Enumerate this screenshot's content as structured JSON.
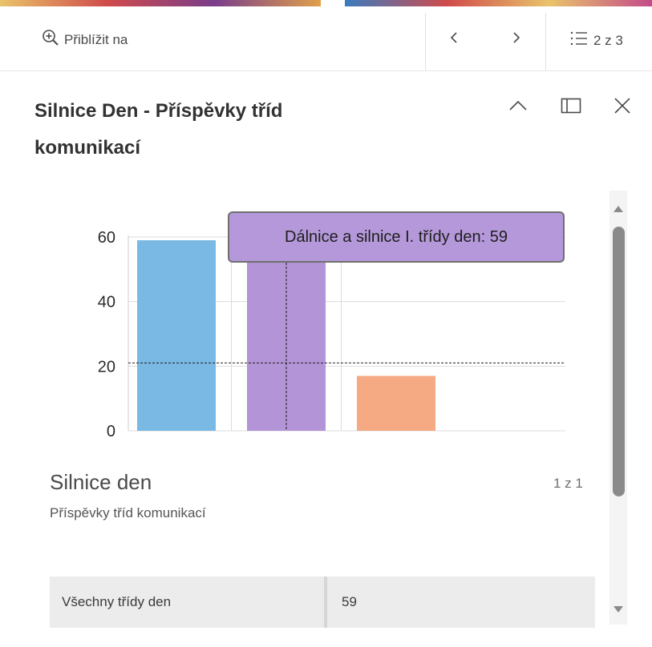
{
  "toolbar": {
    "zoom_label": "Přiblížit na",
    "zoom_icon": "zoom-in-icon",
    "prev_icon": "chevron-left-icon",
    "next_icon": "chevron-right-icon",
    "list_icon": "list-icon",
    "counter_text": "2 z 3"
  },
  "popup": {
    "title_line1": "Silnice Den - Příspěvky tříd",
    "title_line2": "komunikací",
    "collapse_icon": "chevron-up-icon",
    "dock_icon": "dock-icon",
    "close_icon": "close-icon"
  },
  "chart_data": {
    "type": "bar",
    "categories": [
      "",
      "",
      ""
    ],
    "values": [
      59,
      59,
      17
    ],
    "colors": [
      "#7ab9e3",
      "#b394d6",
      "#f6aa83"
    ],
    "ylim": [
      0,
      60
    ],
    "yticks": [
      0,
      20,
      40,
      60
    ],
    "ytick_labels": [
      "0",
      "20",
      "40",
      "60"
    ],
    "grid": true,
    "hover_index": 1,
    "hover_y": 21,
    "tooltip_text": "Dálnice a silnice I. třídy den: 59"
  },
  "media": {
    "title": "Silnice den",
    "subtitle": "Příspěvky tříd komunikací",
    "page_text": "1 z 1"
  },
  "fields": [
    {
      "key": "Všechny třídy den",
      "value": "59"
    }
  ],
  "stripe_colors": [
    "#e9c46a",
    "#d04b4b",
    "#7a3d8a",
    "#3a7bbf"
  ]
}
